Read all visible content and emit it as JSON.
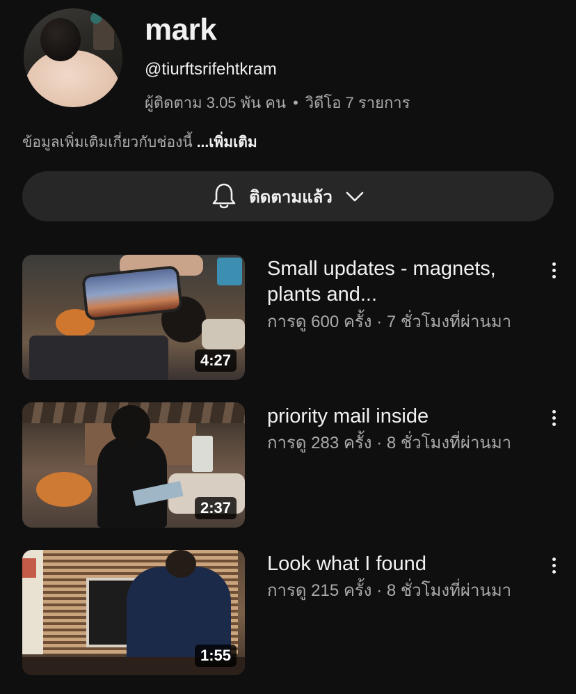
{
  "channel": {
    "name": "mark",
    "handle": "@tiurftsrifehtkram",
    "subscribers": "ผู้ติดตาม 3.05 พัน คน",
    "separator": "•",
    "videos_count": "วิดีโอ 7 รายการ",
    "about": "ข้อมูลเพิ่มเติมเกี่ยวกับช่องนี้",
    "more_label": "...เพิ่มเติม"
  },
  "subscribe": {
    "label": "ติดตามแล้ว",
    "icon": "bell-icon",
    "dropdown_icon": "chevron-down-icon"
  },
  "videos": [
    {
      "title": "Small updates - magnets, plants and...",
      "meta": "การดู 600 ครั้ง · 7 ชั่วโมงที่ผ่านมา",
      "duration": "4:27"
    },
    {
      "title": "priority mail inside",
      "meta": "การดู 283 ครั้ง · 8 ชั่วโมงที่ผ่านมา",
      "duration": "2:37"
    },
    {
      "title": "Look what I found",
      "meta": "การดู 215 ครั้ง · 8 ชั่วโมงที่ผ่านมา",
      "duration": "1:55"
    }
  ],
  "colors": {
    "background": "#0f0f0f",
    "button_bg": "#272727",
    "secondary_text": "#aaaaaa",
    "primary_text": "#f1f1f1"
  }
}
